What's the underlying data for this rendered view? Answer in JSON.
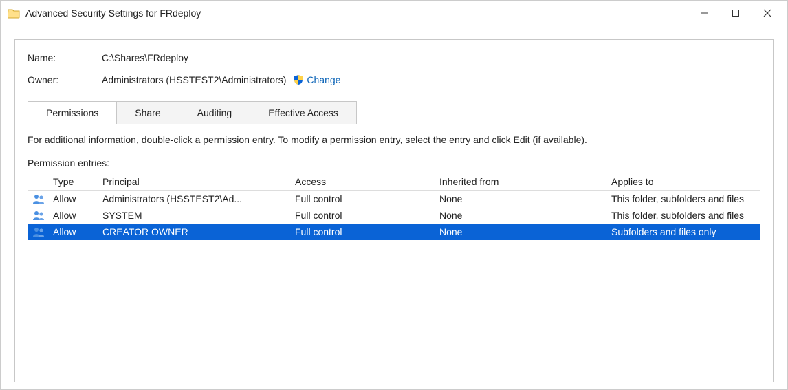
{
  "window": {
    "title": "Advanced Security Settings for FRdeploy"
  },
  "info": {
    "name_label": "Name:",
    "name_value": "C:\\Shares\\FRdeploy",
    "owner_label": "Owner:",
    "owner_value": "Administrators (HSSTEST2\\Administrators)",
    "change_link": "Change"
  },
  "tabs": {
    "permissions": "Permissions",
    "share": "Share",
    "auditing": "Auditing",
    "effective": "Effective Access",
    "active_index": 0
  },
  "panel": {
    "info_line": "For additional information, double-click a permission entry. To modify a permission entry, select the entry and click Edit (if available).",
    "entries_label": "Permission entries:"
  },
  "headers": {
    "type": "Type",
    "principal": "Principal",
    "access": "Access",
    "inherited": "Inherited from",
    "applies": "Applies to"
  },
  "entries": [
    {
      "type": "Allow",
      "principal": "Administrators (HSSTEST2\\Ad...",
      "access": "Full control",
      "inherited": "None",
      "applies": "This folder, subfolders and files",
      "selected": false
    },
    {
      "type": "Allow",
      "principal": "SYSTEM",
      "access": "Full control",
      "inherited": "None",
      "applies": "This folder, subfolders and files",
      "selected": false
    },
    {
      "type": "Allow",
      "principal": "CREATOR OWNER",
      "access": "Full control",
      "inherited": "None",
      "applies": "Subfolders and files only",
      "selected": true
    }
  ]
}
